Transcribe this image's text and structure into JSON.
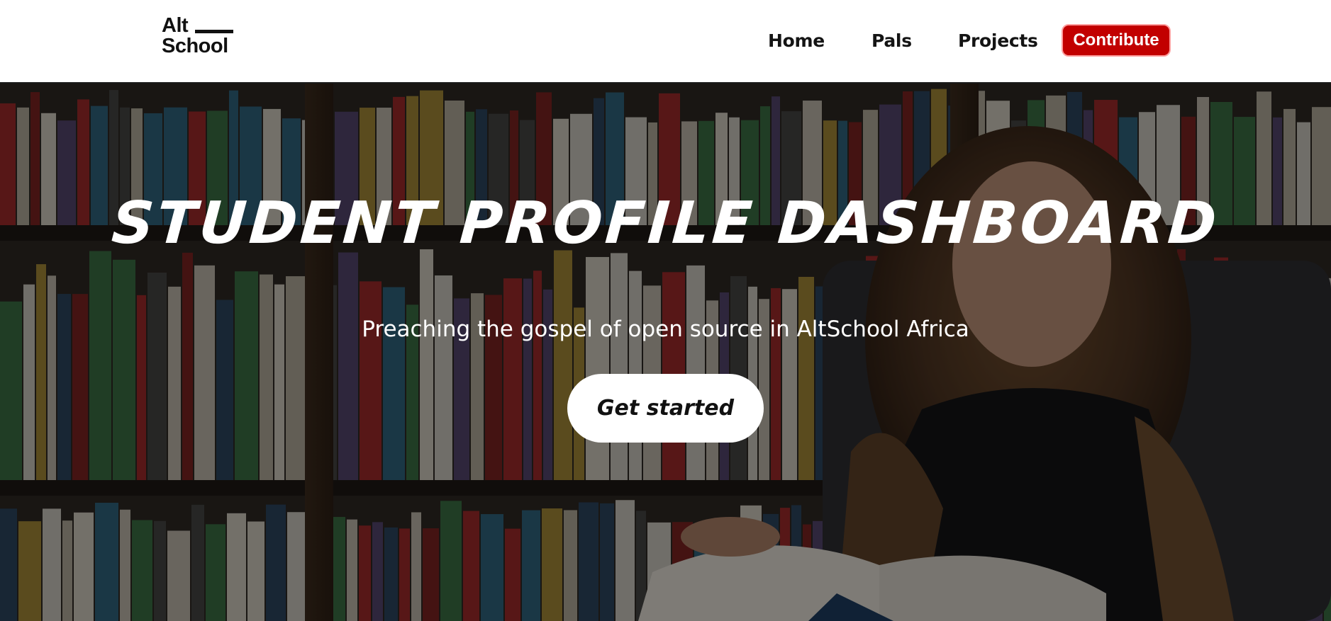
{
  "header": {
    "logo": {
      "line1": "Alt",
      "line2": "School"
    },
    "nav": {
      "home": "Home",
      "pals": "Pals",
      "projects": "Projects",
      "contribute": "Contribute"
    }
  },
  "hero": {
    "title": "STUDENT PROFILE DASHBOARD",
    "subtitle": "Preaching the gospel of open source in AltSchool Africa",
    "cta_label": "Get started",
    "background_image": "student-reading-in-library-photo"
  },
  "colors": {
    "accent": "#c20000",
    "header_bg": "#ffffff",
    "text_dark": "#141414",
    "hero_text": "#ffffff"
  }
}
